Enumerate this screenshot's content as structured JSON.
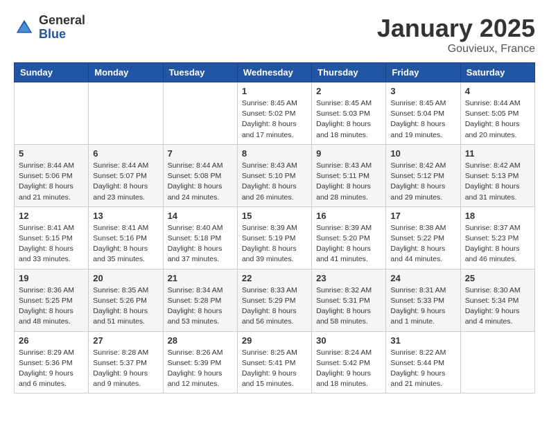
{
  "header": {
    "logo": {
      "general": "General",
      "blue": "Blue"
    },
    "title": "January 2025",
    "location": "Gouvieux, France"
  },
  "weekdays": [
    "Sunday",
    "Monday",
    "Tuesday",
    "Wednesday",
    "Thursday",
    "Friday",
    "Saturday"
  ],
  "weeks": [
    [
      {
        "day": "",
        "info": ""
      },
      {
        "day": "",
        "info": ""
      },
      {
        "day": "",
        "info": ""
      },
      {
        "day": "1",
        "info": "Sunrise: 8:45 AM\nSunset: 5:02 PM\nDaylight: 8 hours\nand 17 minutes."
      },
      {
        "day": "2",
        "info": "Sunrise: 8:45 AM\nSunset: 5:03 PM\nDaylight: 8 hours\nand 18 minutes."
      },
      {
        "day": "3",
        "info": "Sunrise: 8:45 AM\nSunset: 5:04 PM\nDaylight: 8 hours\nand 19 minutes."
      },
      {
        "day": "4",
        "info": "Sunrise: 8:44 AM\nSunset: 5:05 PM\nDaylight: 8 hours\nand 20 minutes."
      }
    ],
    [
      {
        "day": "5",
        "info": "Sunrise: 8:44 AM\nSunset: 5:06 PM\nDaylight: 8 hours\nand 21 minutes."
      },
      {
        "day": "6",
        "info": "Sunrise: 8:44 AM\nSunset: 5:07 PM\nDaylight: 8 hours\nand 23 minutes."
      },
      {
        "day": "7",
        "info": "Sunrise: 8:44 AM\nSunset: 5:08 PM\nDaylight: 8 hours\nand 24 minutes."
      },
      {
        "day": "8",
        "info": "Sunrise: 8:43 AM\nSunset: 5:10 PM\nDaylight: 8 hours\nand 26 minutes."
      },
      {
        "day": "9",
        "info": "Sunrise: 8:43 AM\nSunset: 5:11 PM\nDaylight: 8 hours\nand 28 minutes."
      },
      {
        "day": "10",
        "info": "Sunrise: 8:42 AM\nSunset: 5:12 PM\nDaylight: 8 hours\nand 29 minutes."
      },
      {
        "day": "11",
        "info": "Sunrise: 8:42 AM\nSunset: 5:13 PM\nDaylight: 8 hours\nand 31 minutes."
      }
    ],
    [
      {
        "day": "12",
        "info": "Sunrise: 8:41 AM\nSunset: 5:15 PM\nDaylight: 8 hours\nand 33 minutes."
      },
      {
        "day": "13",
        "info": "Sunrise: 8:41 AM\nSunset: 5:16 PM\nDaylight: 8 hours\nand 35 minutes."
      },
      {
        "day": "14",
        "info": "Sunrise: 8:40 AM\nSunset: 5:18 PM\nDaylight: 8 hours\nand 37 minutes."
      },
      {
        "day": "15",
        "info": "Sunrise: 8:39 AM\nSunset: 5:19 PM\nDaylight: 8 hours\nand 39 minutes."
      },
      {
        "day": "16",
        "info": "Sunrise: 8:39 AM\nSunset: 5:20 PM\nDaylight: 8 hours\nand 41 minutes."
      },
      {
        "day": "17",
        "info": "Sunrise: 8:38 AM\nSunset: 5:22 PM\nDaylight: 8 hours\nand 44 minutes."
      },
      {
        "day": "18",
        "info": "Sunrise: 8:37 AM\nSunset: 5:23 PM\nDaylight: 8 hours\nand 46 minutes."
      }
    ],
    [
      {
        "day": "19",
        "info": "Sunrise: 8:36 AM\nSunset: 5:25 PM\nDaylight: 8 hours\nand 48 minutes."
      },
      {
        "day": "20",
        "info": "Sunrise: 8:35 AM\nSunset: 5:26 PM\nDaylight: 8 hours\nand 51 minutes."
      },
      {
        "day": "21",
        "info": "Sunrise: 8:34 AM\nSunset: 5:28 PM\nDaylight: 8 hours\nand 53 minutes."
      },
      {
        "day": "22",
        "info": "Sunrise: 8:33 AM\nSunset: 5:29 PM\nDaylight: 8 hours\nand 56 minutes."
      },
      {
        "day": "23",
        "info": "Sunrise: 8:32 AM\nSunset: 5:31 PM\nDaylight: 8 hours\nand 58 minutes."
      },
      {
        "day": "24",
        "info": "Sunrise: 8:31 AM\nSunset: 5:33 PM\nDaylight: 9 hours\nand 1 minute."
      },
      {
        "day": "25",
        "info": "Sunrise: 8:30 AM\nSunset: 5:34 PM\nDaylight: 9 hours\nand 4 minutes."
      }
    ],
    [
      {
        "day": "26",
        "info": "Sunrise: 8:29 AM\nSunset: 5:36 PM\nDaylight: 9 hours\nand 6 minutes."
      },
      {
        "day": "27",
        "info": "Sunrise: 8:28 AM\nSunset: 5:37 PM\nDaylight: 9 hours\nand 9 minutes."
      },
      {
        "day": "28",
        "info": "Sunrise: 8:26 AM\nSunset: 5:39 PM\nDaylight: 9 hours\nand 12 minutes."
      },
      {
        "day": "29",
        "info": "Sunrise: 8:25 AM\nSunset: 5:41 PM\nDaylight: 9 hours\nand 15 minutes."
      },
      {
        "day": "30",
        "info": "Sunrise: 8:24 AM\nSunset: 5:42 PM\nDaylight: 9 hours\nand 18 minutes."
      },
      {
        "day": "31",
        "info": "Sunrise: 8:22 AM\nSunset: 5:44 PM\nDaylight: 9 hours\nand 21 minutes."
      },
      {
        "day": "",
        "info": ""
      }
    ]
  ]
}
